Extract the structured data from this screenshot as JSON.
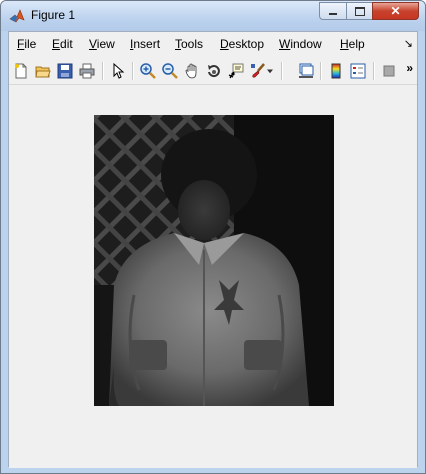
{
  "window": {
    "title": "Figure 1",
    "min_icon": "minimize-icon",
    "max_icon": "maximize-icon",
    "close_icon": "close-icon",
    "close_glyph": "✕"
  },
  "menu": {
    "items": [
      {
        "key": "F",
        "rest": "ile"
      },
      {
        "key": "E",
        "rest": "dit"
      },
      {
        "key": "V",
        "rest": "iew"
      },
      {
        "key": "I",
        "rest": "nsert"
      },
      {
        "key": "T",
        "rest": "ools"
      },
      {
        "key": "D",
        "rest": "esktop"
      },
      {
        "key": "W",
        "rest": "indow"
      },
      {
        "key": "H",
        "rest": "elp"
      }
    ],
    "dock_glyph": "↘"
  },
  "toolbar": {
    "buttons": [
      "new-figure-icon",
      "open-file-icon",
      "save-icon",
      "print-icon",
      "edit-plot-icon",
      "zoom-in-icon",
      "zoom-out-icon",
      "pan-icon",
      "rotate-3d-icon",
      "data-cursor-icon",
      "brush-icon",
      "brush-dropdown-icon",
      "link-plot-icon",
      "colorbar-icon",
      "legend-icon",
      "plot-tools-icon"
    ],
    "more_glyph": "»"
  },
  "figure": {
    "content": "grayscale photograph of a child in a jacket"
  }
}
